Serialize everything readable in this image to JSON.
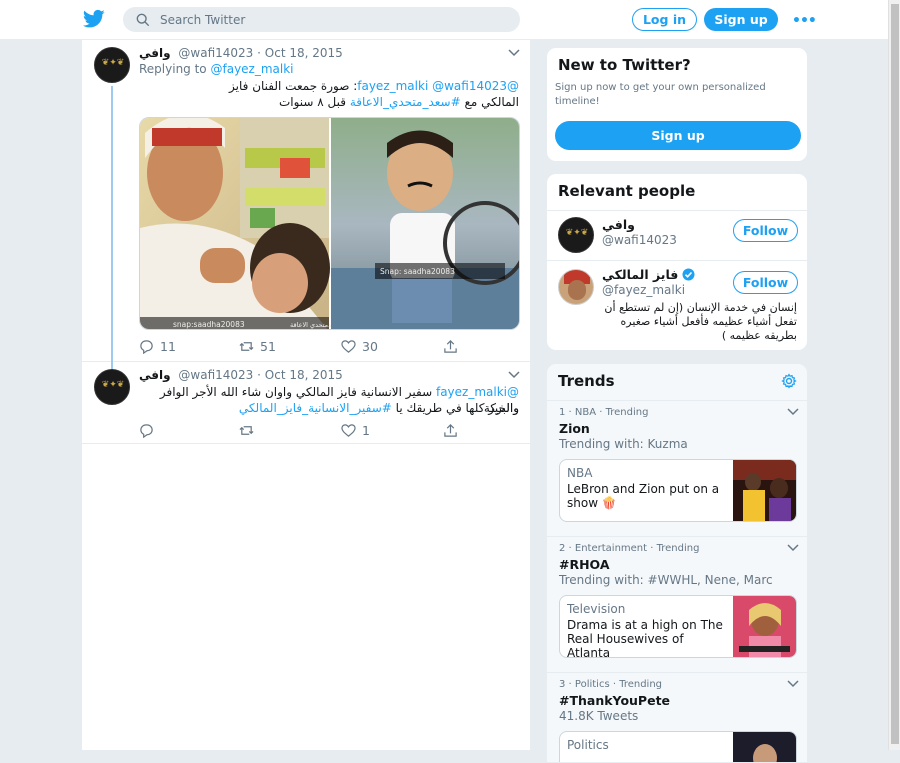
{
  "header": {
    "search_placeholder": "Search Twitter",
    "login_label": "Log in",
    "signup_label": "Sign up",
    "more_label": "•••"
  },
  "colors": {
    "accent": "#1da1f2",
    "background": "#e6ecf0",
    "text_primary": "#14171a",
    "text_secondary": "#657786"
  },
  "tweets": [
    {
      "display_name": "وافي",
      "handle": "@wafi14023",
      "date": "· Oct 18, 2015",
      "replying_prefix": "Replying to",
      "replying_to": "@fayez_malki",
      "line1_mentions": "@fayez_malki @wafi14023",
      "line1_text": ": صورة جمعت الفنان فايز",
      "line2_text": "المالكي مع",
      "line2_hashtag": "#سعد_متحدي_الاعاقة",
      "line2_suffix": " قبل ٨ سنوات",
      "image_watermark_left": "snap:saadha20083",
      "image_watermark_right": "Snap: saadha20083",
      "image_caption_left": "سعدمتحدي الاعاقة",
      "replies": "11",
      "retweets": "51",
      "likes": "30"
    },
    {
      "display_name": "وافي",
      "handle": "@wafi14023",
      "date": "· Oct 18, 2015",
      "line1_mention": "@fayez_malki",
      "line1_text": " سفير الانسانية فايز المالكي واوان شاء الله الأجر الوافر والبركة",
      "line2_text": "والخير كلها في طريقك يا",
      "line2_hashtag": "#سفير_الانسانية_فايز_المالكي",
      "replies": "",
      "retweets": "",
      "likes": "1"
    }
  ],
  "signup_card": {
    "title": "New to Twitter?",
    "subtitle": "Sign up now to get your own personalized timeline!",
    "button": "Sign up"
  },
  "relevant": {
    "title": "Relevant people",
    "people": [
      {
        "name": "وافي",
        "handle": "@wafi14023",
        "follow": "Follow",
        "bio": ""
      },
      {
        "name": "فايز المالكي",
        "handle": "@fayez_malki",
        "follow": "Follow",
        "verified": true,
        "bio": "إنسان في خدمة الإنسان (إن لم تستطع أن تفعل أشياء عظيمه فأفعل أشياء صغيره بطريقه عظيمه )"
      }
    ]
  },
  "trends": {
    "title": "Trends",
    "items": [
      {
        "meta": "1 · NBA · Trending",
        "name": "Zion",
        "with": "Trending with: Kuzma",
        "card_category": "NBA",
        "card_headline": "LeBron and Zion put on a show 🍿"
      },
      {
        "meta": "2 · Entertainment · Trending",
        "name": "#RHOA",
        "with": "Trending with: #WWHL, Nene, Marc",
        "card_category": "Television",
        "card_headline": "Drama is at a high on The Real Housewives of Atlanta"
      },
      {
        "meta": "3 · Politics · Trending",
        "name": "#ThankYouPete",
        "with": "41.8K Tweets",
        "card_category": "Politics",
        "card_headline": ""
      }
    ]
  }
}
